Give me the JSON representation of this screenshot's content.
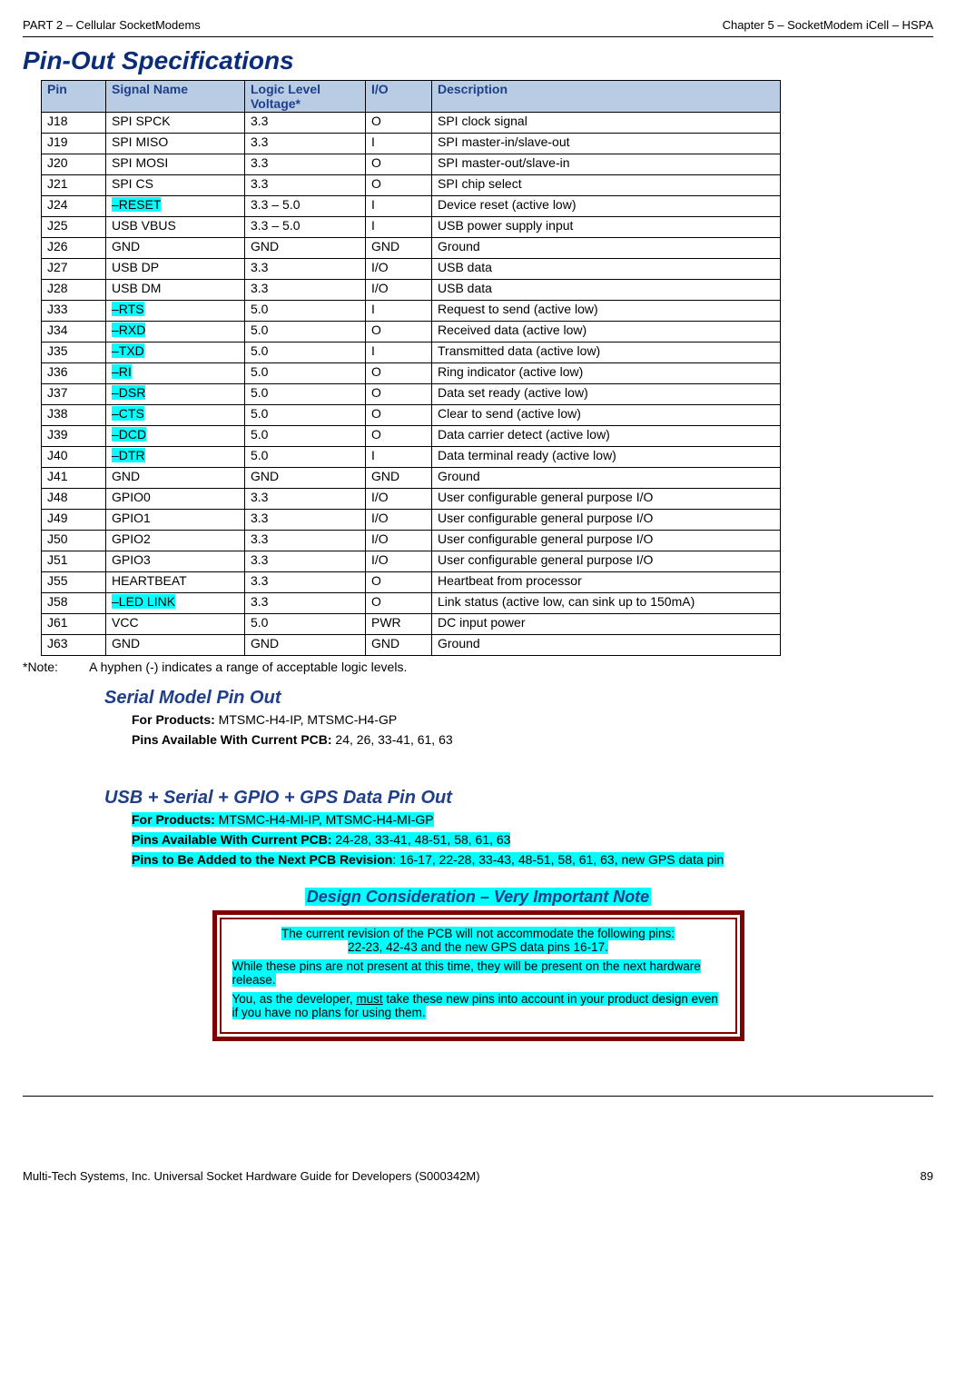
{
  "header": {
    "left": "PART 2 – Cellular SocketModems",
    "right": "Chapter 5 – SocketModem iCell – HSPA"
  },
  "title": "Pin-Out Specifications",
  "table_headers": {
    "pin": "Pin",
    "signal": "Signal Name",
    "logic": "Logic Level Voltage*",
    "io": "I/O",
    "desc": "Description"
  },
  "rows": [
    {
      "pin": "J18",
      "signal": "SPI SPCK",
      "logic": "3.3",
      "io": "O",
      "desc": "SPI clock signal",
      "hl": false
    },
    {
      "pin": "J19",
      "signal": "SPI MISO",
      "logic": "3.3",
      "io": "I",
      "desc": "SPI master-in/slave-out",
      "hl": false
    },
    {
      "pin": "J20",
      "signal": "SPI MOSI",
      "logic": "3.3",
      "io": "O",
      "desc": "SPI master-out/slave-in",
      "hl": false
    },
    {
      "pin": "J21",
      "signal": "SPI CS",
      "logic": "3.3",
      "io": "O",
      "desc": "SPI chip select",
      "hl": false
    },
    {
      "pin": "J24",
      "signal": "–RESET",
      "logic": "3.3 – 5.0",
      "io": "I",
      "desc": "Device reset (active low)",
      "hl": true
    },
    {
      "pin": "J25",
      "signal": "USB VBUS",
      "logic": "3.3 – 5.0",
      "io": "I",
      "desc": "USB power supply input",
      "hl": false
    },
    {
      "pin": "J26",
      "signal": "GND",
      "logic": "GND",
      "io": "GND",
      "desc": "Ground",
      "hl": false
    },
    {
      "pin": "J27",
      "signal": "USB DP",
      "logic": "3.3",
      "io": "I/O",
      "desc": "USB data",
      "hl": false
    },
    {
      "pin": "J28",
      "signal": "USB DM",
      "logic": "3.3",
      "io": "I/O",
      "desc": "USB data",
      "hl": false
    },
    {
      "pin": "J33",
      "signal": "–RTS",
      "logic": "5.0",
      "io": "I",
      "desc": "Request to send (active low)",
      "hl": true
    },
    {
      "pin": "J34",
      "signal": "–RXD",
      "logic": "5.0",
      "io": "O",
      "desc": "Received data (active low)",
      "hl": true
    },
    {
      "pin": "J35",
      "signal": "–TXD",
      "logic": "5.0",
      "io": "I",
      "desc": "Transmitted data (active low)",
      "hl": true
    },
    {
      "pin": "J36",
      "signal": "–RI",
      "logic": "5.0",
      "io": "O",
      "desc": "Ring indicator (active low)",
      "hl": true
    },
    {
      "pin": "J37",
      "signal": "–DSR",
      "logic": "5.0",
      "io": "O",
      "desc": "Data set ready (active low)",
      "hl": true
    },
    {
      "pin": "J38",
      "signal": "–CTS",
      "logic": "5.0",
      "io": "O",
      "desc": "Clear to send (active low)",
      "hl": true
    },
    {
      "pin": "J39",
      "signal": "–DCD",
      "logic": "5.0",
      "io": "O",
      "desc": "Data carrier detect (active low)",
      "hl": true
    },
    {
      "pin": "J40",
      "signal": "–DTR",
      "logic": "5.0",
      "io": "I",
      "desc": "Data terminal ready (active low)",
      "hl": true
    },
    {
      "pin": "J41",
      "signal": "GND",
      "logic": "GND",
      "io": "GND",
      "desc": "Ground",
      "hl": false
    },
    {
      "pin": "J48",
      "signal": "GPIO0",
      "logic": "3.3",
      "io": "I/O",
      "desc": "User configurable general purpose I/O",
      "hl": false
    },
    {
      "pin": "J49",
      "signal": "GPIO1",
      "logic": "3.3",
      "io": "I/O",
      "desc": "User configurable general purpose I/O",
      "hl": false
    },
    {
      "pin": "J50",
      "signal": "GPIO2",
      "logic": "3.3",
      "io": "I/O",
      "desc": "User configurable general purpose I/O",
      "hl": false
    },
    {
      "pin": "J51",
      "signal": "GPIO3",
      "logic": "3.3",
      "io": "I/O",
      "desc": "User configurable general purpose I/O",
      "hl": false
    },
    {
      "pin": "J55",
      "signal": "HEARTBEAT",
      "logic": "3.3",
      "io": "O",
      "desc": "Heartbeat from processor",
      "hl": false
    },
    {
      "pin": "J58",
      "signal": "–LED LINK",
      "logic": "3.3",
      "io": "O",
      "desc": "Link status (active low, can sink up to 150mA)",
      "hl": true
    },
    {
      "pin": "J61",
      "signal": "VCC",
      "logic": "5.0",
      "io": "PWR",
      "desc": "DC input power",
      "hl": false
    },
    {
      "pin": "J63",
      "signal": "GND",
      "logic": "GND",
      "io": "GND",
      "desc": "Ground",
      "hl": false
    }
  ],
  "note": {
    "label": "*Note:",
    "text": "A hyphen (-) indicates a range of acceptable logic levels."
  },
  "serial": {
    "title": "Serial Model Pin Out",
    "for_products_label": "For Products:",
    "for_products_value": " MTSMC-H4-IP, MTSMC-H4-GP",
    "pins_label": "Pins Available With Current PCB:",
    "pins_value": " 24, 26, 33-41, 61, 63"
  },
  "usb": {
    "title": "USB + Serial + GPIO + GPS Data Pin Out",
    "for_products_label": "For Products:",
    "for_products_value": " MTSMC-H4-MI-IP, MTSMC-H4-MI-GP",
    "pins_label": "Pins Available With Current PCB:",
    "pins_value": " 24-28, 33-41, 48-51, 58, 61, 63",
    "pins_next_label": "Pins to Be Added to the Next PCB Revision",
    "pins_next_value": ": 16-17, 22-28, 33-43, 48-51, 58, 61, 63, new GPS data pin"
  },
  "design": {
    "heading": "Design Consideration – Very Important Note",
    "p1a": "The current revision of the PCB will not accommodate the following pins:",
    "p1b": "22-23, 42-43 and the new GPS data pins 16-17.",
    "p2": "While these pins are not present at this time, they will be present on the next hardware release.",
    "p3a": "You, as the developer, ",
    "p3b": "must",
    "p3c": " take these new pins into account in your product design even if you have no plans for using them."
  },
  "footer": {
    "left": "Multi-Tech Systems, Inc. Universal Socket Hardware Guide for Developers (S000342M)",
    "right": "89"
  }
}
